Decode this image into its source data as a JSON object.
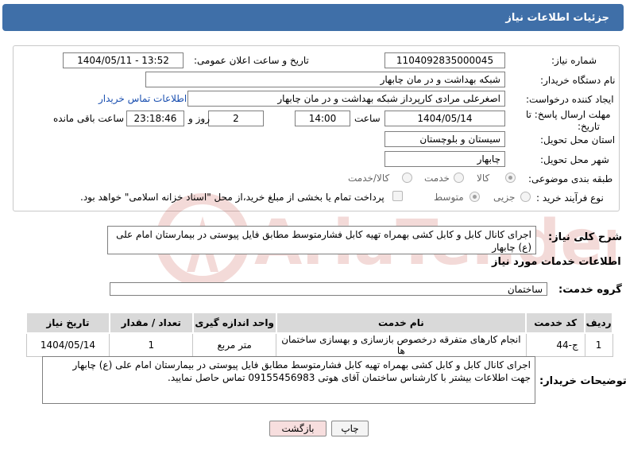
{
  "header": {
    "title": "جزئیات اطلاعات نیاز"
  },
  "form": {
    "need_number_label": "شماره نیاز:",
    "need_number": "1104092835000045",
    "announce_label": "تاریخ و ساعت اعلان عمومی:",
    "announce_value": "1404/05/11 - 13:52",
    "buyer_org_label": "نام دستگاه خریدار:",
    "buyer_org": "شبکه بهداشت و در مان چابهار",
    "creator_label": "ایجاد کننده درخواست:",
    "creator": "اصغرعلی مرادی کارپرداز شبکه بهداشت و در مان چابهار",
    "contact_link": "اطلاعات تماس خریدار",
    "deadline_label_1": "مهلت ارسال پاسخ: تا",
    "deadline_label_2": "تاریخ:",
    "deadline_date": "1404/05/14",
    "time_label": "ساعت",
    "deadline_time": "14:00",
    "days_value": "2",
    "days_label": "روز و",
    "remaining_time": "23:18:46",
    "remaining_label": "ساعت باقی مانده",
    "province_label": "استان محل تحویل:",
    "province": "سیستان و بلوچستان",
    "city_label": "شهر محل تحویل:",
    "city": "چابهار",
    "category_label": "طبقه بندی موضوعی:",
    "category_options": [
      "کالا",
      "خدمت",
      "کالا/خدمت"
    ],
    "process_label": "نوع فرآیند خرید :",
    "process_options": [
      "جزیی",
      "متوسط"
    ],
    "payment_note": "پرداخت تمام یا بخشی از مبلغ خرید،از محل \"اسناد خزانه اسلامی\" خواهد بود."
  },
  "summary": {
    "label": "شرح کلی نیاز:",
    "text": "اجرای کانال کابل و کابل کشی بهمراه تهیه کابل فشارمتوسط مطابق فایل پیوستی در بیمارستان امام علی (ع) چابهار"
  },
  "services": {
    "section_title": "اطلاعات خدمات مورد نیاز",
    "group_label": "گروه خدمت:",
    "group_value": "ساختمان",
    "columns": [
      "ردیف",
      "کد خدمت",
      "نام خدمت",
      "واحد اندازه گیری",
      "تعداد / مقدار",
      "تاریخ نیاز"
    ],
    "rows": [
      [
        "1",
        "ج-44",
        "انجام کارهای متفرقه درخصوص بازسازی و بهسازی ساختمان ها",
        "متر مربع",
        "1",
        "1404/05/14"
      ]
    ]
  },
  "buyer_notes": {
    "label": "توضیحات خریدار:",
    "line1": "اجرای کانال کابل و کابل کشی بهمراه تهیه کابل فشارمتوسط مطابق فایل پیوستی در بیمارستان امام علی (ع) چابهار",
    "line2": "جهت اطلاعات بیشتر با کارشناس ساختمان آقای هوتی 09155456983 تماس حاصل نمایید."
  },
  "buttons": {
    "print": "چاپ",
    "back": "بازگشت"
  },
  "watermark_text": "AriaTender.neT",
  "colors": {
    "header": "#3f6fa8",
    "back_button": "#f7dede",
    "link": "#1a4fb0",
    "watermark": "#c0392b"
  }
}
